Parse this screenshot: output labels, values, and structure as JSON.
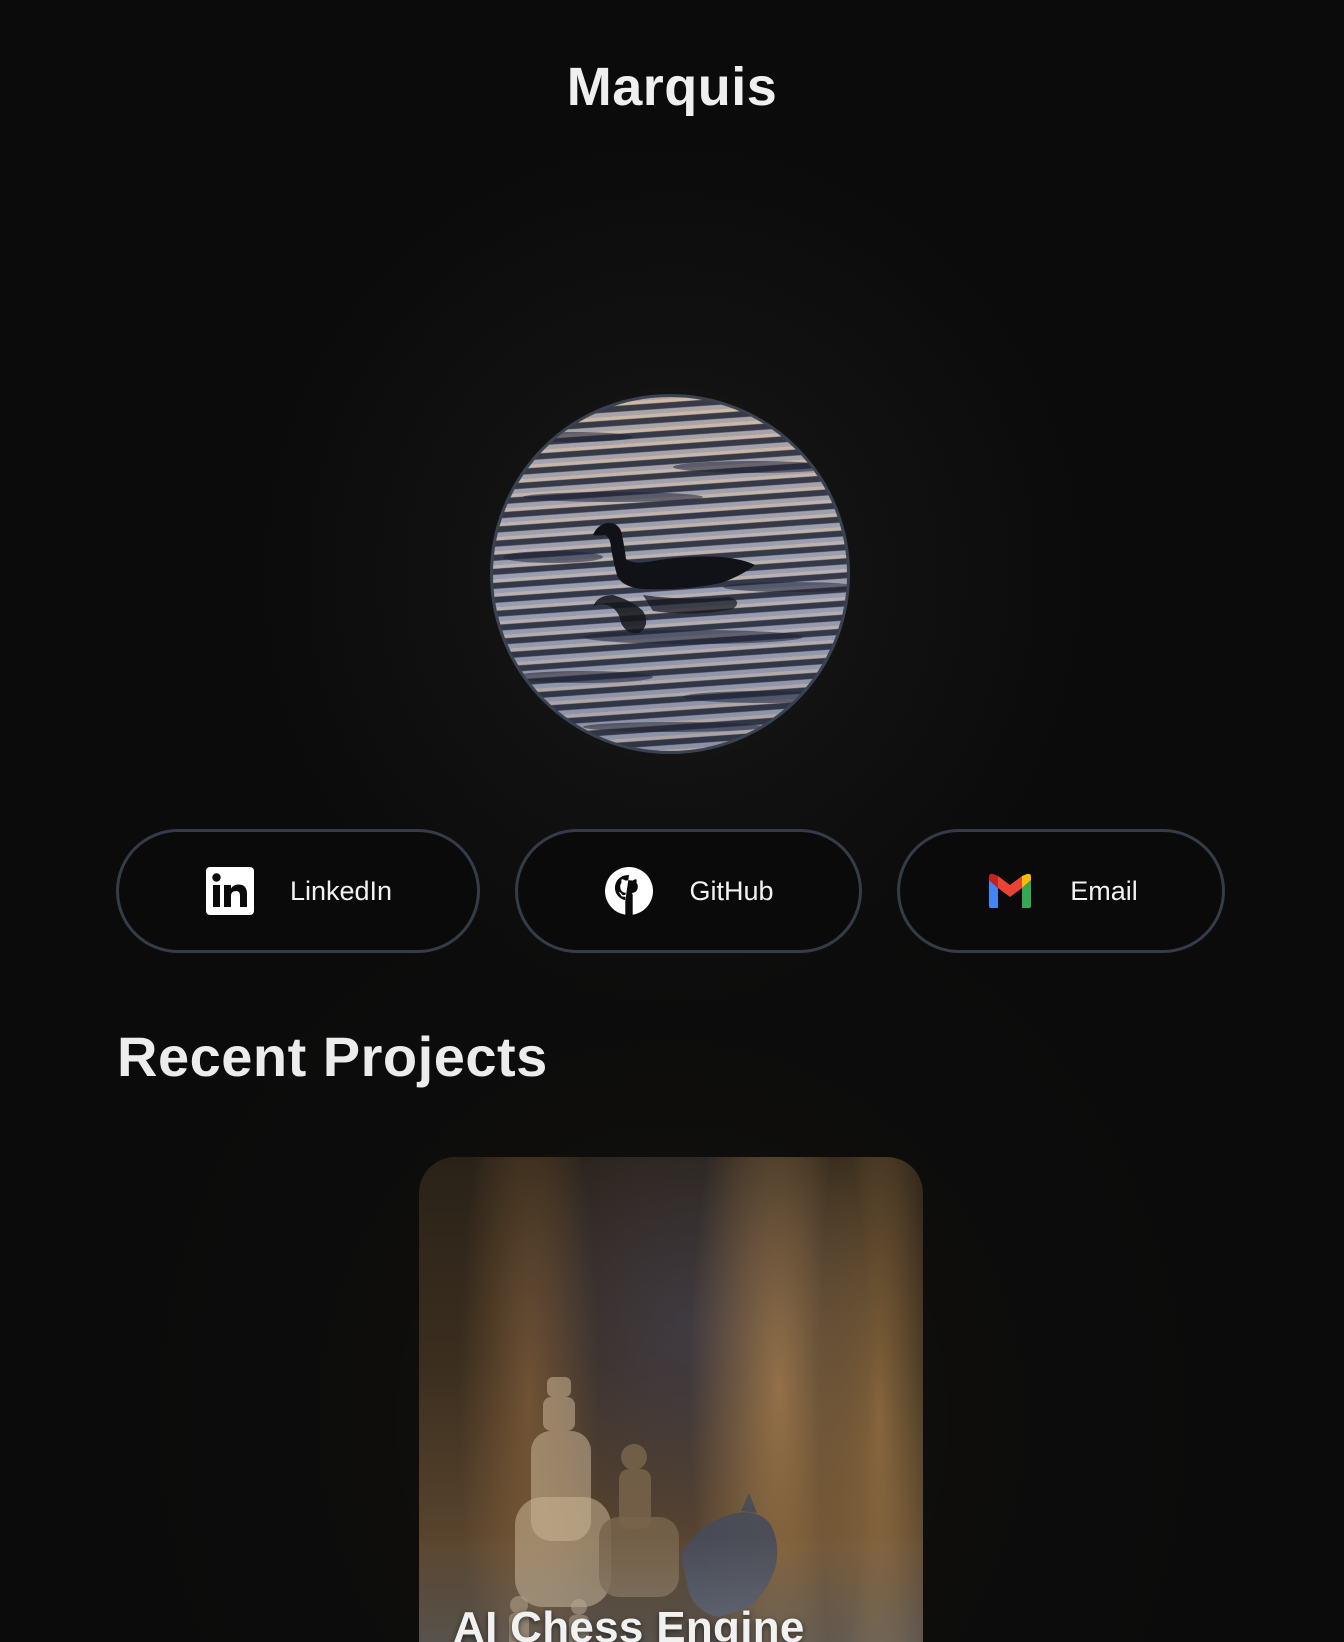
{
  "site": {
    "title": "Marquis"
  },
  "avatar": {
    "icon": "swimming-goose-photo",
    "alt": ""
  },
  "links": [
    {
      "label": "LinkedIn",
      "icon": "linkedin-icon"
    },
    {
      "label": "GitHub",
      "icon": "github-icon"
    },
    {
      "label": "Email",
      "icon": "gmail-icon"
    }
  ],
  "projects_section": {
    "title": "Recent Projects"
  },
  "projects": [
    {
      "title": "AI Chess Engine",
      "image": "chess-pieces-photo"
    }
  ],
  "colors": {
    "background": "#0b0b0b",
    "button_border": "#353c47",
    "text": "#f2f2f2"
  }
}
